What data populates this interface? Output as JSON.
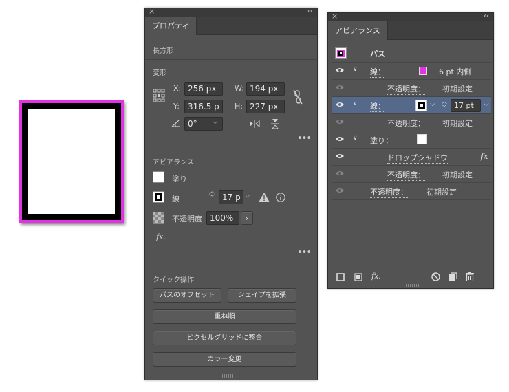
{
  "properties_panel": {
    "tab": "プロパティ",
    "object_type": "長方形",
    "transform": {
      "header": "変形",
      "x_label": "X:",
      "x_value": "256 px",
      "y_label": "Y:",
      "y_value": "316.5 p",
      "w_label": "W:",
      "w_value": "194 px",
      "h_label": "H:",
      "h_value": "227 px",
      "angle_value": "0°"
    },
    "appearance": {
      "header": "アピアランス",
      "fill_label": "塗り",
      "stroke_label": "線",
      "stroke_weight": "17 p",
      "opacity_label": "不透明度",
      "opacity_value": "100%",
      "fx_label": "fx."
    },
    "quick_actions": {
      "header": "クイック操作",
      "offset_path": "パスのオフセット",
      "expand_shape": "シェイプを拡張",
      "arrange": "重ね順",
      "align_pixel": "ピクセルグリッドに整合",
      "recolor": "カラー変更"
    }
  },
  "appearance_panel": {
    "tab": "アピアランス",
    "header_item": "パス",
    "rows": [
      {
        "label": "線：",
        "extra": "6 pt  内側",
        "swatch": "#e233e2"
      },
      {
        "label": "不透明度：",
        "value": "初期設定"
      },
      {
        "label": "線：",
        "weight": "17 pt",
        "selected": true
      },
      {
        "label": "不透明度：",
        "value": "初期設定"
      },
      {
        "label": "塗り：",
        "swatch": "#ffffff"
      },
      {
        "label": "ドロップシャドウ",
        "fx": "fx"
      },
      {
        "label": "不透明度：",
        "value": "初期設定"
      },
      {
        "label": "不透明度：",
        "value": "初期設定"
      }
    ],
    "bottom_fx": "fx."
  },
  "colors": {
    "panel_bg": "#535353",
    "accent_magenta": "#e233e2",
    "selected_row": "#55698a"
  }
}
